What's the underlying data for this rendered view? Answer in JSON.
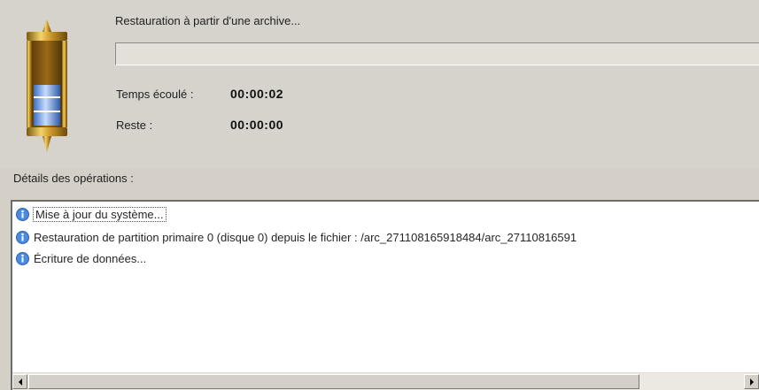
{
  "operation": {
    "title": "Restauration à partir d'une archive...",
    "progress_percent": 0
  },
  "time": {
    "elapsed_label": "Temps écoulé :",
    "elapsed_value": "00:00:02",
    "remaining_label": "Reste :",
    "remaining_value": "00:00:00"
  },
  "details": {
    "label": "Détails des opérations :",
    "entries": [
      {
        "icon": "info-icon",
        "text": "Mise à jour du système..."
      },
      {
        "icon": "info-icon",
        "text": "Restauration de partition primaire 0 (disque 0) depuis le fichier : /arc_271108165918484/arc_27110816591"
      },
      {
        "icon": "info-icon",
        "text": "Écriture de données..."
      }
    ]
  },
  "colors": {
    "progress_fill": "#2f6fd6",
    "info_icon": "#4a8be0"
  }
}
